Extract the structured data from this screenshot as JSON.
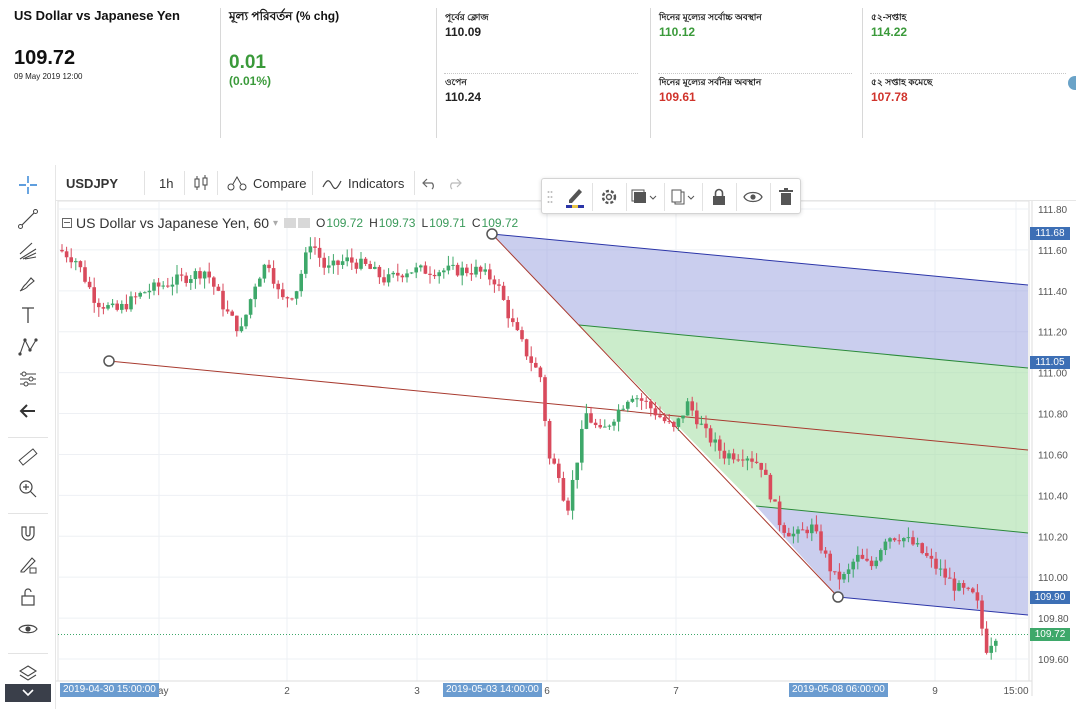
{
  "quote": {
    "title": "US Dollar vs Japanese Yen",
    "price": "109.72",
    "timestamp": "09 May 2019 12:00",
    "change_label": "মূল্য পরিবর্তন (% chg)",
    "change": "0.01",
    "change_pct": "(0.01%)",
    "prev_close_label": "পূর্বের ক্লোজ",
    "prev_close": "110.09",
    "open_label": "ওপেন",
    "open": "110.24",
    "day_high_label": "দিনের মূল্যের সর্বোচ্চ অবস্থান",
    "day_high": "110.12",
    "day_low_label": "দিনের মূল্যের সর্বনিম্ন অবস্থান",
    "day_low": "109.61",
    "wk52_high_label": "৫২-সপ্তাহ",
    "wk52_high": "114.22",
    "wk52_low_label": "৫২ সপ্তাহ কমেছে",
    "wk52_low": "107.78"
  },
  "toolbar": {
    "symbol": "USDJPY",
    "interval": "1h",
    "compare_label": "Compare",
    "indicators_label": "Indicators"
  },
  "legend": {
    "name": "US Dollar vs Japanese Yen, 60",
    "o_key": "O",
    "o_val": "109.72",
    "h_key": "H",
    "h_val": "109.73",
    "l_key": "L",
    "l_val": "109.71",
    "c_key": "C",
    "c_val": "109.72"
  },
  "price_axis": {
    "ticks": [
      "111.80",
      "111.60",
      "111.40",
      "111.20",
      "111.00",
      "110.80",
      "110.60",
      "110.40",
      "110.20",
      "110.00",
      "109.80",
      "109.60"
    ],
    "tags": [
      {
        "label": "111.68",
        "color": "#3d6fb5",
        "price": 111.68
      },
      {
        "label": "111.05",
        "color": "#3d6fb5",
        "price": 111.05
      },
      {
        "label": "109.90",
        "color": "#3d6fb5",
        "price": 109.9
      },
      {
        "label": "109.72",
        "color": "#3ea86a",
        "price": 109.72
      }
    ]
  },
  "time_axis": {
    "ticks": [
      "May",
      "2",
      "3",
      "6",
      "7",
      "9",
      "15:00"
    ],
    "tags": [
      "2019-04-30 15:00:00",
      "2019-05-03 14:00:00",
      "2019-05-08 06:00:00"
    ]
  },
  "colors": {
    "up": "#3ea86a",
    "down": "#d94a5c",
    "pitchfork_blue_fill": "#9ea6e0",
    "pitchfork_green_fill": "#a9dfa9",
    "median_line": "#a83a2f",
    "blue_line": "#2b35a8",
    "green_line": "#2a8a3a",
    "tag_blue": "#3d6fb5"
  },
  "chart_data": {
    "type": "candlestick",
    "symbol": "USDJPY",
    "timeframe": "60",
    "ylim": [
      109.5,
      111.85
    ],
    "last_price": 109.72
  }
}
